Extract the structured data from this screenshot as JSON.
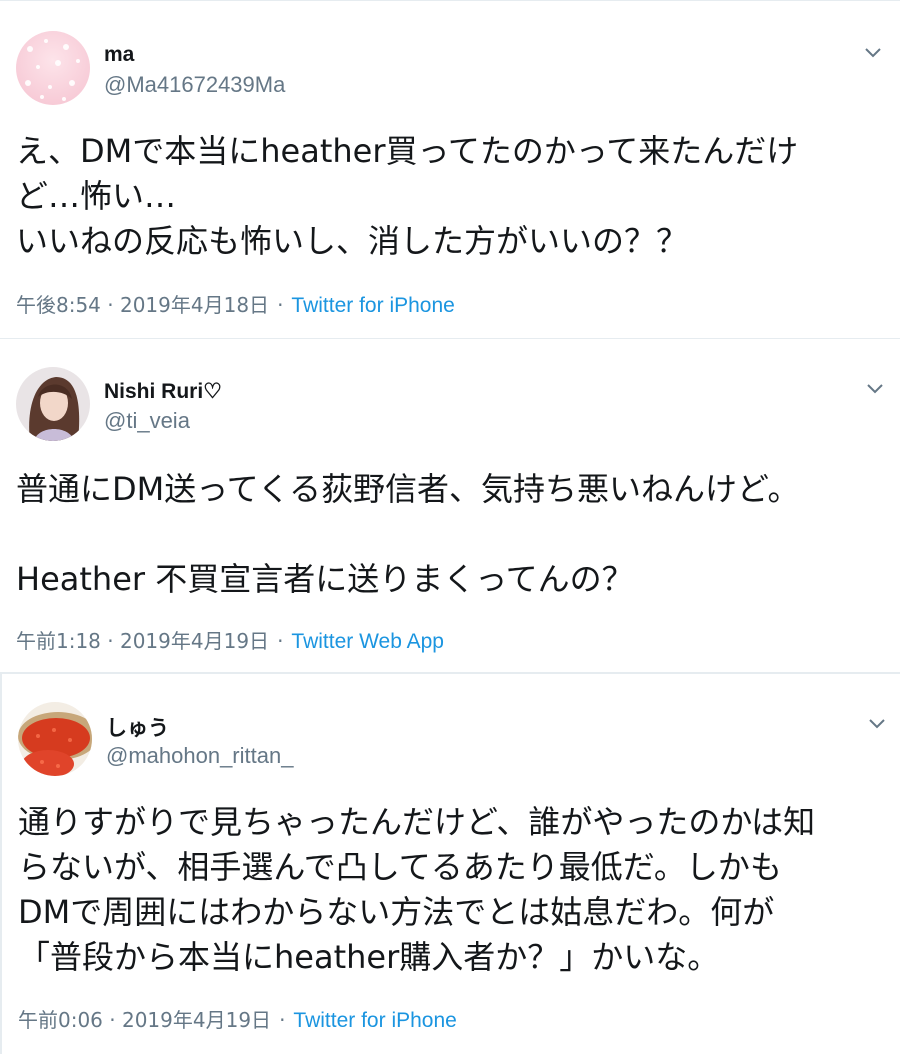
{
  "tweets": [
    {
      "name": "ma",
      "handle": "@Ma41672439Ma",
      "lines": [
        "え、DMで本当にheather買ってたのかって来たんだけ",
        "ど…怖い…",
        "いいねの反応も怖いし、消した方がいいの？？"
      ],
      "time": "午後8:54 · 2019年4月18日",
      "source": "Twitter for iPhone"
    },
    {
      "name": "Nishi Ruri♡",
      "handle": "@ti_veia",
      "lines": [
        "普通にDM送ってくる荻野信者、気持ち悪いねんけど。",
        "",
        "Heather 不買宣言者に送りまくってんの？"
      ],
      "time": "午前1:18 · 2019年4月19日",
      "source": "Twitter Web App"
    },
    {
      "name": "しゅう",
      "handle": "@mahohon_rittan_",
      "lines": [
        "通りすがりで見ちゃったんだけど、誰がやったのかは知",
        "らないが、相手選んで凸してるあたり最低だ。しかも",
        "DMで周囲にはわからない方法でとは姑息だわ。何が",
        "「普段から本当にheather購入者か？」かいな。"
      ],
      "time": "午前0:06 · 2019年4月19日",
      "source": "Twitter for iPhone"
    }
  ],
  "colors": {
    "text": "#14171a",
    "secondary": "#657786",
    "link": "#1b95e0",
    "border": "#e6ecf0"
  },
  "icons": {
    "more": "chevron-down-icon"
  }
}
